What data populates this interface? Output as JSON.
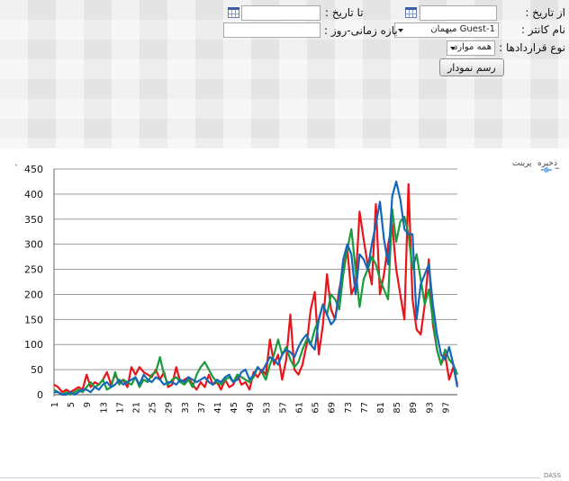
{
  "filters": {
    "from_date_label": "از تاریخ :",
    "from_date_value": "",
    "to_date_label": "تا تاریخ :",
    "to_date_value": "",
    "counter_label": "نام کانتر :",
    "counter_selected": "Guest-1 میهمان",
    "period_label": "بازه زمانی-روز :",
    "period_value": "",
    "contract_type_label": "نوع قراردادها :",
    "contract_type_selected": "همه موارد",
    "draw_button": "رسم نمودار",
    "calendar_icon": "calendar-icon"
  },
  "chart_menu": {
    "save": "ذخیره",
    "print": "پرینت"
  },
  "legend": {
    "label": "–",
    "color": "#7cb5ec"
  },
  "corner_glyph": "`",
  "footer_text": "DASS",
  "chart_data": {
    "type": "line",
    "title": "",
    "xlabel": "",
    "ylabel": "",
    "ylim": [
      0,
      450
    ],
    "yticks": [
      0,
      50,
      100,
      150,
      200,
      250,
      300,
      350,
      400,
      450
    ],
    "xlim": [
      1,
      100
    ],
    "xticks": [
      1,
      5,
      9,
      13,
      17,
      21,
      25,
      29,
      33,
      37,
      41,
      45,
      49,
      53,
      57,
      61,
      65,
      69,
      73,
      77,
      81,
      85,
      89,
      93,
      97
    ],
    "grid": "horizontal",
    "series": [
      {
        "color": "#e8151b",
        "values": [
          20,
          15,
          5,
          10,
          5,
          10,
          15,
          10,
          40,
          15,
          25,
          20,
          30,
          45,
          20,
          40,
          25,
          30,
          15,
          55,
          40,
          55,
          45,
          40,
          35,
          50,
          30,
          45,
          15,
          20,
          55,
          25,
          30,
          35,
          20,
          10,
          25,
          15,
          40,
          20,
          25,
          10,
          30,
          15,
          20,
          40,
          20,
          25,
          10,
          45,
          35,
          50,
          40,
          110,
          60,
          80,
          30,
          70,
          160,
          50,
          40,
          60,
          100,
          170,
          205,
          80,
          140,
          240,
          170,
          150,
          210,
          250,
          290,
          200,
          220,
          365,
          310,
          260,
          220,
          380,
          200,
          240,
          300,
          340,
          250,
          200,
          150,
          420,
          190,
          130,
          120,
          180,
          270,
          140,
          90,
          60,
          80,
          30,
          55,
          20
        ]
      },
      {
        "color": "#1a9b3c",
        "values": [
          10,
          5,
          0,
          5,
          0,
          5,
          10,
          5,
          15,
          25,
          15,
          20,
          30,
          10,
          15,
          45,
          20,
          30,
          25,
          20,
          35,
          15,
          30,
          25,
          40,
          45,
          75,
          40,
          20,
          30,
          35,
          25,
          20,
          30,
          15,
          40,
          55,
          65,
          50,
          35,
          25,
          20,
          30,
          35,
          25,
          40,
          35,
          30,
          25,
          35,
          55,
          45,
          30,
          60,
          80,
          110,
          80,
          95,
          70,
          55,
          65,
          90,
          110,
          100,
          130,
          150,
          180,
          160,
          200,
          190,
          170,
          240,
          290,
          330,
          250,
          175,
          230,
          250,
          275,
          260,
          230,
          210,
          190,
          370,
          305,
          345,
          355,
          320,
          250,
          280,
          230,
          180,
          210,
          150,
          90,
          60,
          90,
          70,
          60,
          40
        ]
      },
      {
        "color": "#1567b8",
        "values": [
          5,
          5,
          0,
          0,
          5,
          0,
          5,
          10,
          10,
          5,
          15,
          10,
          20,
          25,
          15,
          20,
          30,
          20,
          25,
          30,
          35,
          20,
          40,
          30,
          25,
          35,
          30,
          20,
          25,
          25,
          20,
          30,
          25,
          35,
          30,
          25,
          30,
          35,
          25,
          20,
          30,
          25,
          35,
          40,
          25,
          30,
          45,
          50,
          30,
          40,
          55,
          45,
          60,
          75,
          70,
          60,
          80,
          90,
          85,
          75,
          95,
          110,
          120,
          100,
          90,
          150,
          180,
          160,
          140,
          150,
          200,
          270,
          300,
          280,
          200,
          280,
          270,
          250,
          300,
          340,
          385,
          310,
          260,
          395,
          425,
          390,
          330,
          320,
          320,
          150,
          220,
          240,
          260,
          180,
          120,
          80,
          70,
          95,
          60,
          15
        ]
      }
    ]
  }
}
